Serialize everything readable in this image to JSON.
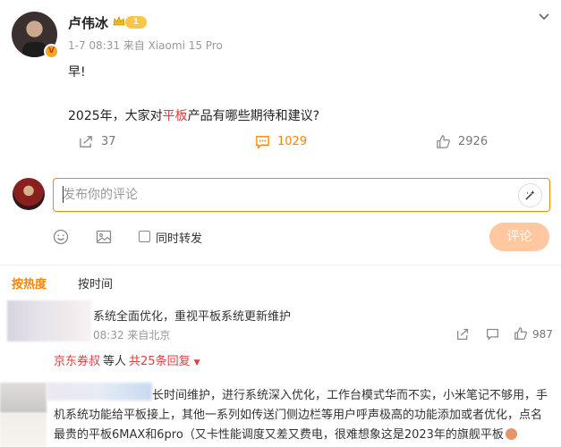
{
  "post": {
    "username": "卢伟冰",
    "level": "1",
    "verified_badge": "V",
    "meta": "1-7 08:31  来自 Xiaomi 15 Pro",
    "line1": "早!",
    "line2_before": "2025年，大家对",
    "line2_highlight": "平板",
    "line2_after": "产品有哪些期待和建议?",
    "shares": "37",
    "comments": "1029",
    "likes": "2926",
    "highlight_color": "#e03c3c",
    "accent_color": "#ff8200"
  },
  "composer": {
    "placeholder": "发布你的评论",
    "repost_label": "同时转发",
    "submit_label": "评论",
    "icons": [
      "emoji-icon",
      "image-icon",
      "ai-assist-icon"
    ]
  },
  "tabs": {
    "hot": "按热度",
    "time": "按时间"
  },
  "comments": [
    {
      "text": "系统全面优化，重视平板系统更新维护",
      "meta": "08:32  来自北京",
      "likes": "987",
      "reply_user": "京东券叔",
      "reply_mid": "等人",
      "reply_count": "共25条回复"
    },
    {
      "line1": "长时间维护，进行系统深入优化，工作台模式华而不实，小米笔记不够用，手",
      "line2": "机系统功能给平板接上，其他一系列如传送门侧边栏等用户呼声极高的功能添加或者优化，点名",
      "line3": "最贵的平板6MAX和6pro（又卡性能调度又差又费电，很难想象这是2023年的旗舰平板"
    }
  ]
}
